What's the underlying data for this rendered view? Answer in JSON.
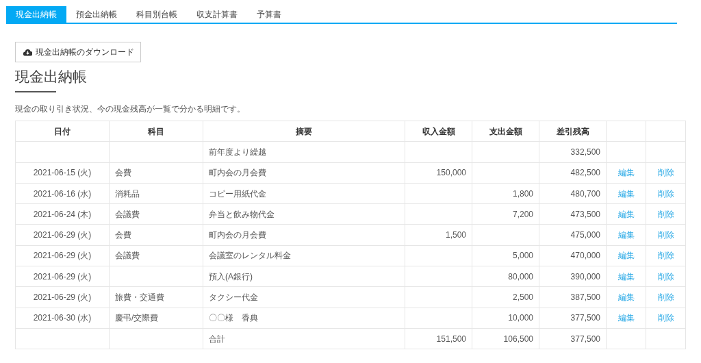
{
  "tabs": [
    {
      "label": "現金出納帳",
      "selected": true
    },
    {
      "label": "預金出納帳",
      "selected": false
    },
    {
      "label": "科目別台帳",
      "selected": false
    },
    {
      "label": "収支計算書",
      "selected": false
    },
    {
      "label": "予算書",
      "selected": false
    }
  ],
  "download_button": "現金出納帳のダウンロード",
  "heading": "現金出納帳",
  "description": "現金の取り引き状況、今の現金残高が一覧で分かる明細です。",
  "table": {
    "columns": [
      "日付",
      "科目",
      "摘要",
      "収入金額",
      "支出金額",
      "差引残高"
    ],
    "rows": [
      {
        "summary": "前年度より繰越",
        "balance": "332,500"
      },
      {
        "date": "2021-06-15 (火)",
        "account": "会費",
        "summary": "町内会の月会費",
        "income": "150,000",
        "balance": "482,500",
        "edit": "編集",
        "delete": "削除"
      },
      {
        "date": "2021-06-16 (水)",
        "account": "消耗品",
        "summary": "コピー用紙代金",
        "expense": "1,800",
        "balance": "480,700",
        "edit": "編集",
        "delete": "削除"
      },
      {
        "date": "2021-06-24 (木)",
        "account": "会議費",
        "summary": "弁当と飲み物代金",
        "expense": "7,200",
        "balance": "473,500",
        "edit": "編集",
        "delete": "削除"
      },
      {
        "date": "2021-06-29 (火)",
        "account": "会費",
        "summary": "町内会の月会費",
        "income": "1,500",
        "balance": "475,000",
        "edit": "編集",
        "delete": "削除"
      },
      {
        "date": "2021-06-29 (火)",
        "account": "会議費",
        "summary": "会議室のレンタル料金",
        "expense": "5,000",
        "balance": "470,000",
        "edit": "編集",
        "delete": "削除"
      },
      {
        "date": "2021-06-29 (火)",
        "summary": "預入(A銀行)",
        "expense": "80,000",
        "balance": "390,000",
        "edit": "編集",
        "delete": "削除"
      },
      {
        "date": "2021-06-29 (火)",
        "account": "旅費・交通費",
        "summary": "タクシー代金",
        "expense": "2,500",
        "balance": "387,500",
        "edit": "編集",
        "delete": "削除"
      },
      {
        "date": "2021-06-30 (水)",
        "account": "慶弔/交際費",
        "summary": "〇〇様　香典",
        "expense": "10,000",
        "balance": "377,500",
        "edit": "編集",
        "delete": "削除"
      },
      {
        "summary": "合計",
        "income": "151,500",
        "expense": "106,500",
        "balance": "377,500"
      }
    ]
  }
}
